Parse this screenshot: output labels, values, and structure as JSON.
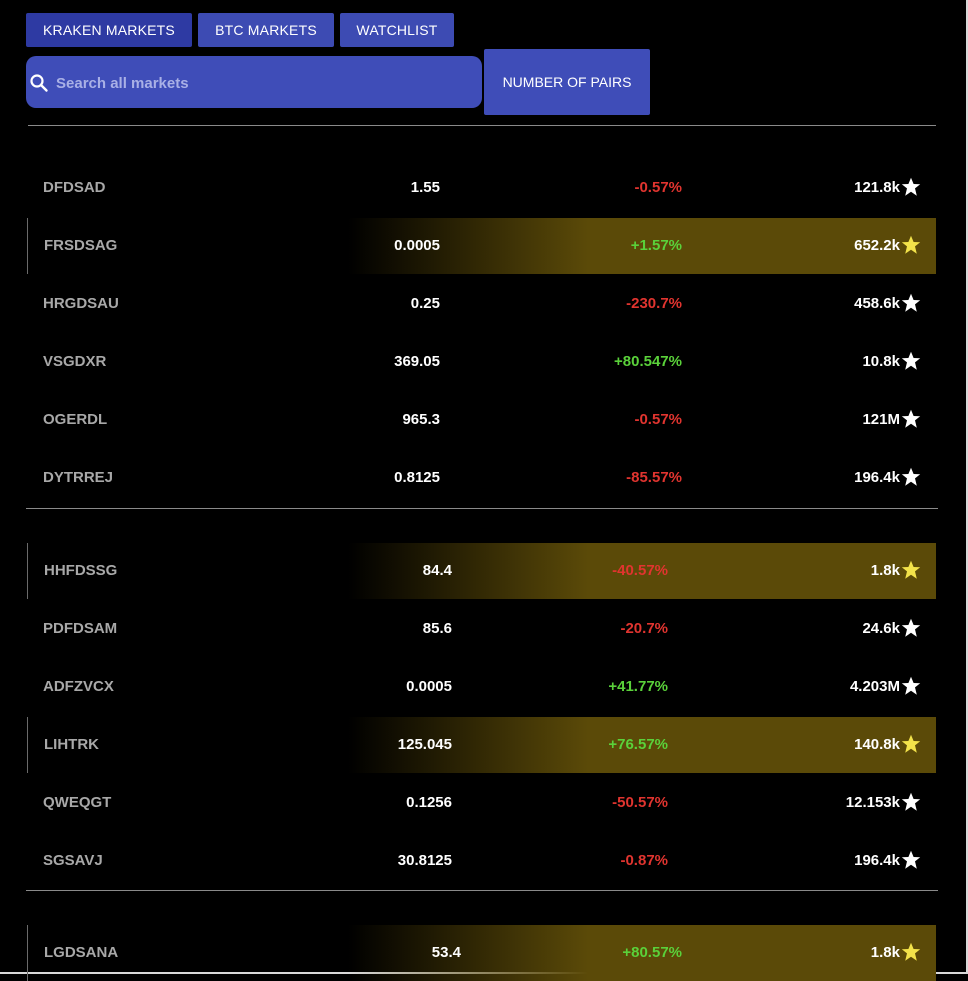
{
  "tabs": [
    {
      "label": "KRAKEN MARKETS",
      "active": true
    },
    {
      "label": "BTC MARKETS",
      "active": false
    },
    {
      "label": "WATCHLIST",
      "active": false
    }
  ],
  "search": {
    "placeholder": "Search all markets",
    "value": ""
  },
  "pairs_button": {
    "label": "NUMBER OF PAIRS"
  },
  "groups": [
    {
      "rows": [
        {
          "symbol": "DFDSAD",
          "price": "1.55",
          "change": "-0.57%",
          "volume": "121.8k",
          "watched": false
        },
        {
          "symbol": "FRSDSAG",
          "price": "0.0005",
          "change": "+1.57%",
          "volume": "652.2k",
          "watched": true
        },
        {
          "symbol": "HRGDSAU",
          "price": "0.25",
          "change": "-230.7%",
          "volume": "458.6k",
          "watched": false
        },
        {
          "symbol": "VSGDXR",
          "price": "369.05",
          "change": "+80.547%",
          "volume": "10.8k",
          "watched": false
        },
        {
          "symbol": "OGERDL",
          "price": "965.3",
          "change": "-0.57%",
          "volume": "121M",
          "watched": false
        },
        {
          "symbol": "DYTRREJ",
          "price": "0.8125",
          "change": "-85.57%",
          "volume": "196.4k",
          "watched": false
        }
      ]
    },
    {
      "rows": [
        {
          "symbol": "HHFDSSG",
          "price": "84.4",
          "change": "-40.57%",
          "volume": "1.8k",
          "watched": true
        },
        {
          "symbol": "PDFDSAM",
          "price": "85.6",
          "change": "-20.7%",
          "volume": "24.6k",
          "watched": false
        },
        {
          "symbol": "ADFZVCX",
          "price": "0.0005",
          "change": "+41.77%",
          "volume": "4.203M",
          "watched": false
        },
        {
          "symbol": "LIHTRK",
          "price": "125.045",
          "change": "+76.57%",
          "volume": "140.8k",
          "watched": true
        },
        {
          "symbol": "QWEQGT",
          "price": "0.1256",
          "change": "-50.57%",
          "volume": "12.153k",
          "watched": false
        },
        {
          "symbol": "SGSAVJ",
          "price": "30.8125",
          "change": "-0.87%",
          "volume": "196.4k",
          "watched": false
        }
      ]
    },
    {
      "rows": [
        {
          "symbol": "LGDSANA",
          "price": "53.4",
          "change": "+80.57%",
          "volume": "1.8k",
          "watched": true
        }
      ]
    }
  ],
  "colors": {
    "tab_bg": "#3d4bb3",
    "negative": "#e0342f",
    "positive": "#5ad13a",
    "watch_highlight": "#5b4a08",
    "star_watched": "#f2e24a",
    "star_default": "#ffffff"
  },
  "icons": {
    "search": "search-icon",
    "star": "star-icon"
  }
}
